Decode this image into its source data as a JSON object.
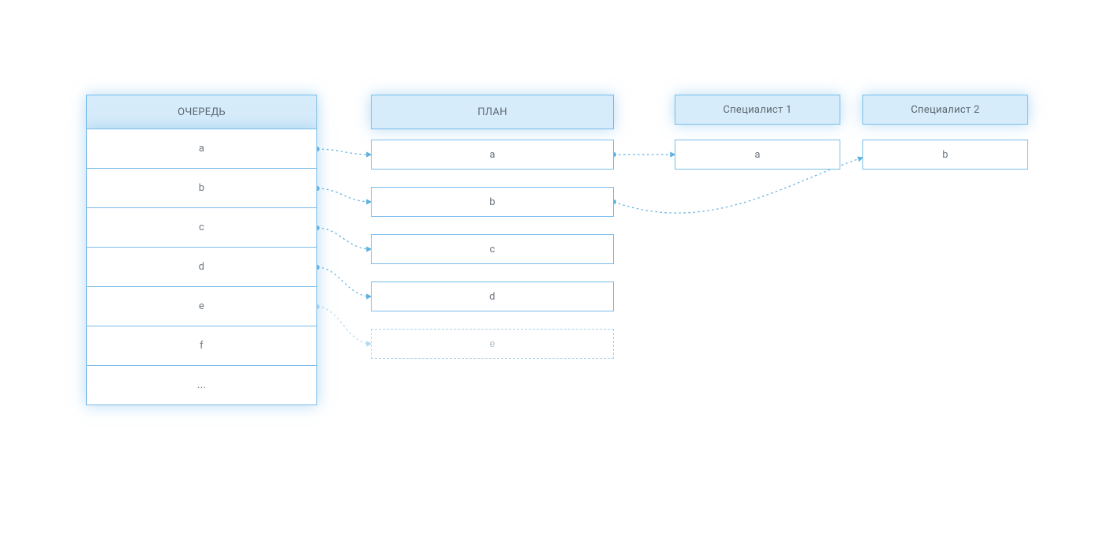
{
  "columns": {
    "queue": {
      "title": "ОЧЕРЕДЬ"
    },
    "plan": {
      "title": "ПЛАН"
    },
    "spec1": {
      "title": "Специалист 1"
    },
    "spec2": {
      "title": "Специалист 2"
    }
  },
  "queue_items": [
    "a",
    "b",
    "c",
    "d",
    "e",
    "f",
    "..."
  ],
  "plan_items": [
    "a",
    "b",
    "c",
    "d"
  ],
  "plan_ghost": "e",
  "spec1_items": [
    "a"
  ],
  "spec2_items": [
    "b"
  ],
  "arrow_style": "dotted",
  "colors": {
    "accent": "#7abcea",
    "header_bg": "#d7ecfa",
    "text": "#647079",
    "glow": "rgba(120,190,235,0.55)"
  }
}
